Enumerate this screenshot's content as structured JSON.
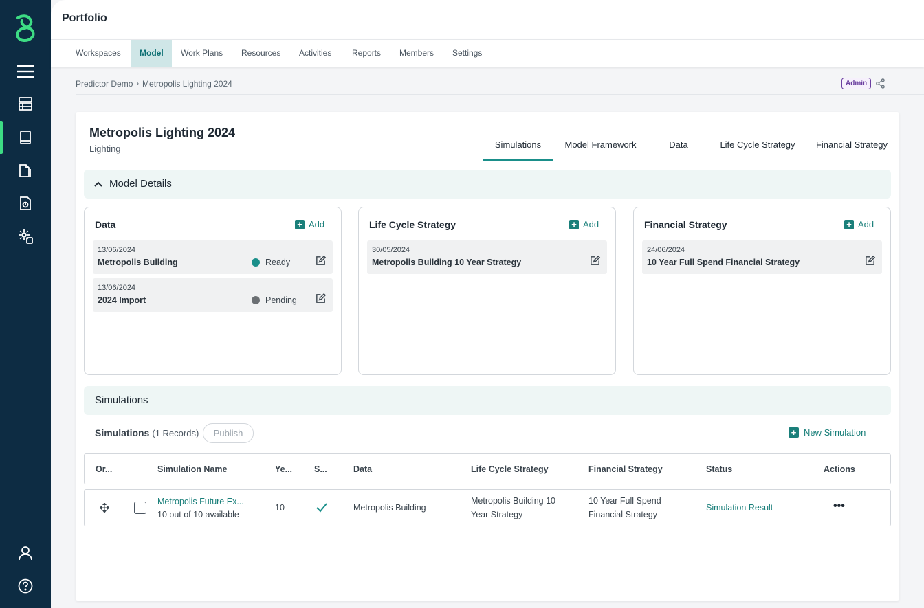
{
  "app": {
    "title": "Portfolio"
  },
  "sidebar": {
    "logo": "brand-logo",
    "items": [
      {
        "name": "menu-icon"
      },
      {
        "name": "workspaces-icon"
      },
      {
        "name": "model-book-icon"
      },
      {
        "name": "documents-icon"
      },
      {
        "name": "reports-icon"
      },
      {
        "name": "settings-gear-icon"
      },
      {
        "name": "user-icon"
      },
      {
        "name": "help-icon"
      }
    ]
  },
  "nav": {
    "items": [
      {
        "label": "Workspaces"
      },
      {
        "label": "Model"
      },
      {
        "label": "Work Plans"
      },
      {
        "label": "Resources"
      },
      {
        "label": "Activities"
      },
      {
        "label": "Reports"
      },
      {
        "label": "Members"
      },
      {
        "label": "Settings"
      }
    ],
    "active": "Model"
  },
  "breadcrumb": {
    "parent": "Predictor Demo",
    "separator": "›",
    "current": "Metropolis Lighting 2024"
  },
  "role_badge": "Admin",
  "model": {
    "title": "Metropolis Lighting 2024",
    "subtitle": "Lighting",
    "tabs": [
      {
        "label": "Simulations"
      },
      {
        "label": "Model Framework"
      },
      {
        "label": "Data"
      },
      {
        "label": "Life Cycle Strategy"
      },
      {
        "label": "Financial Strategy"
      }
    ],
    "active_tab": "Simulations"
  },
  "details": {
    "title": "Model Details",
    "add_label": "Add",
    "cards": [
      {
        "title": "Data",
        "items": [
          {
            "date": "13/06/2024",
            "name": "Metropolis Building",
            "status": "Ready",
            "status_color": "#1a8f8a"
          },
          {
            "date": "13/06/2024",
            "name": "2024 Import",
            "status": "Pending",
            "status_color": "#6b6f73"
          }
        ]
      },
      {
        "title": "Life Cycle Strategy",
        "items": [
          {
            "date": "30/05/2024",
            "name": "Metropolis Building 10 Year Strategy"
          }
        ]
      },
      {
        "title": "Financial Strategy",
        "items": [
          {
            "date": "24/06/2024",
            "name": "10 Year Full Spend Financial Strategy"
          }
        ]
      }
    ]
  },
  "simulations": {
    "section_title": "Simulations",
    "label": "Simulations",
    "count_text": "(1 Records)",
    "publish_label": "Publish",
    "new_label": "New Simulation",
    "columns": [
      "Or...",
      "Simulation Name",
      "Ye...",
      "S...",
      "Data",
      "Life Cycle Strategy",
      "Financial Strategy",
      "Status",
      "Actions"
    ],
    "rows": [
      {
        "name": "Metropolis Future Ex...",
        "availability": "10 out of 10 available",
        "years": "10",
        "data": "Metropolis Building",
        "lcs_line1": "Metropolis Building 10",
        "lcs_line2": "Year Strategy",
        "fs_line1": "10 Year Full Spend",
        "fs_line2": "Financial Strategy",
        "status": "Simulation Result",
        "actions": "•••"
      }
    ]
  },
  "colors": {
    "sidebar": "#0d2c43",
    "accent": "#1a7f7a",
    "brand_green": "#3ddc84",
    "admin": "#6b3fa0"
  }
}
